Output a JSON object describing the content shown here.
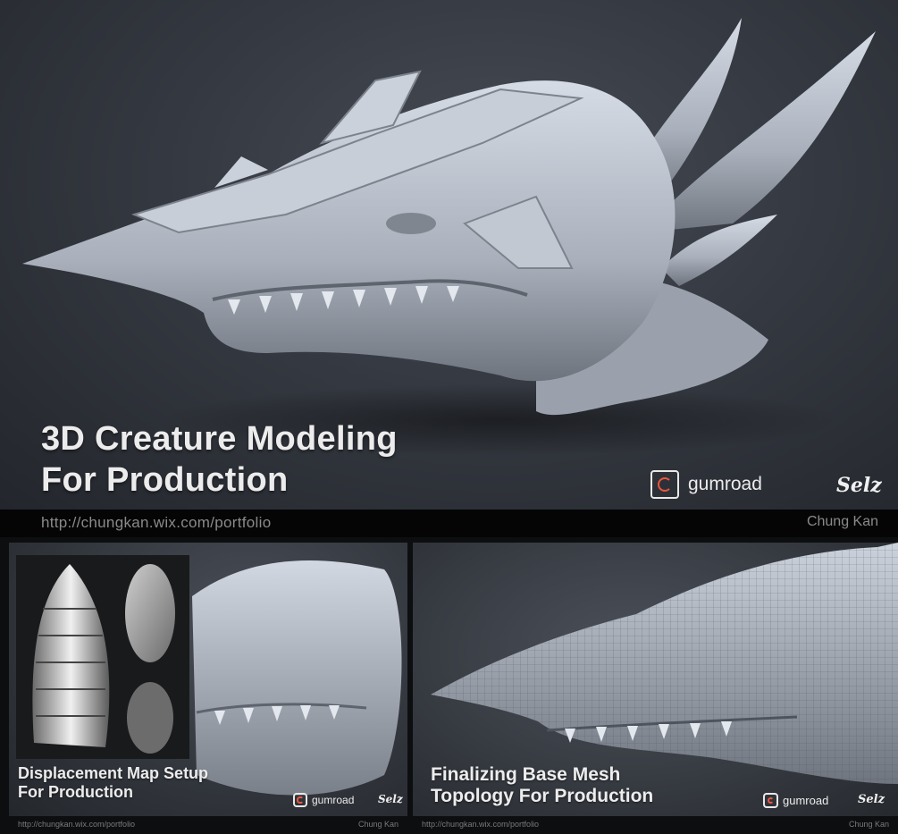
{
  "hero": {
    "title_line1": "3D Creature Modeling",
    "title_line2": "For Production",
    "image": "dragon-head-sculpt"
  },
  "brands": {
    "gumroad": "gumroad",
    "selz": "Selz"
  },
  "footer": {
    "url": "http://chungkan.wix.com/portfolio",
    "author": "Chung Kan"
  },
  "panel_left": {
    "title_line1": "Displacement Map Setup",
    "title_line2": "For Production",
    "image": "displacement-map-preview"
  },
  "panel_right": {
    "title_line1": "Finalizing Base Mesh",
    "title_line2": "Topology For Production",
    "image": "wireframe-mesh-render"
  },
  "colors": {
    "accent": "#e9573f",
    "text": "#ececec",
    "bg": "#0d0e10"
  }
}
